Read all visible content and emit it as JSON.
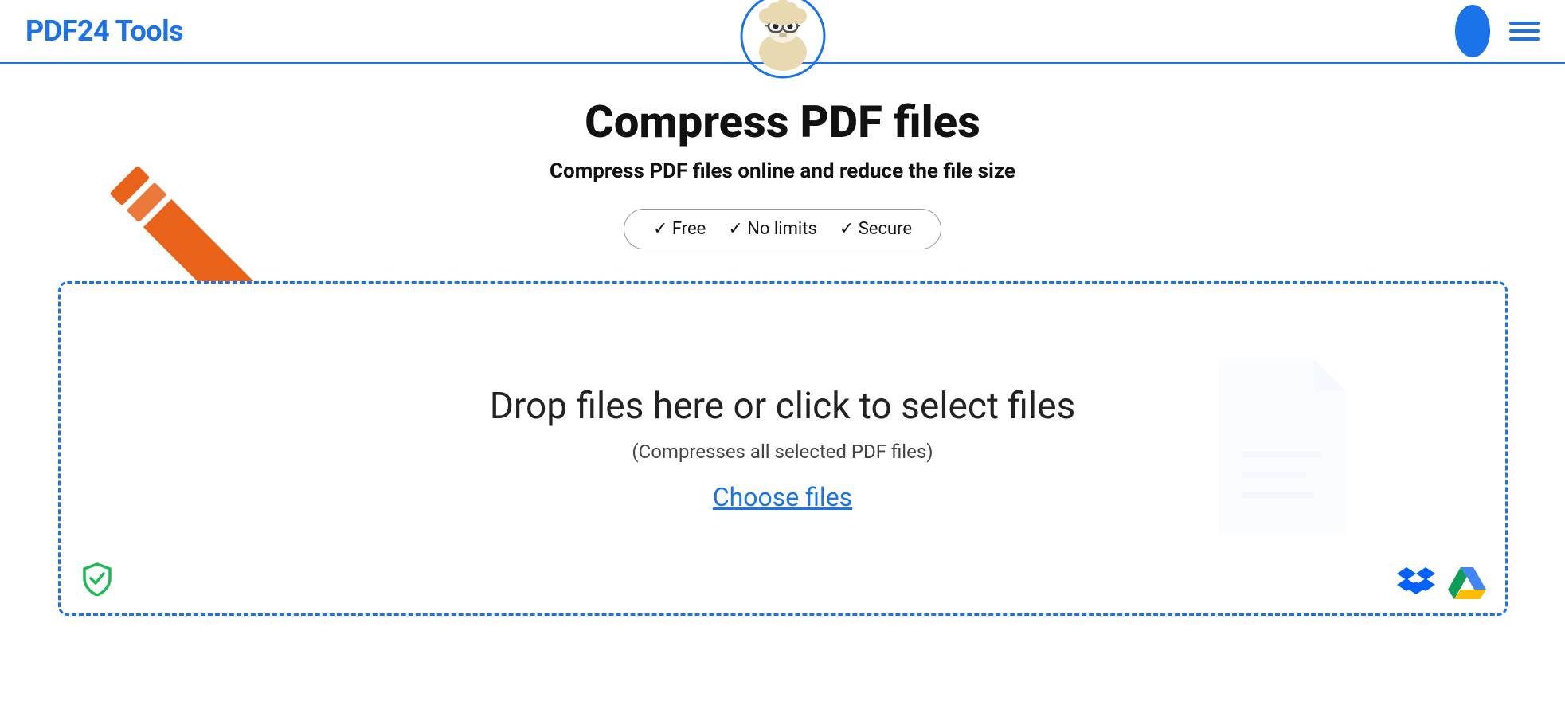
{
  "header": {
    "logo": "PDF24 Tools",
    "avatar_label": "user-avatar",
    "menu_label": "menu"
  },
  "hero": {
    "title": "Compress PDF files",
    "subtitle": "Compress PDF files online and reduce the file size",
    "badges": [
      "✓ Free",
      "✓ No limits",
      "✓ Secure"
    ]
  },
  "dropzone": {
    "main_text": "Drop files here or click to select files",
    "sub_text": "(Compresses all selected PDF files)",
    "choose_files_label": "Choose files"
  },
  "colors": {
    "brand_blue": "#1a73e8",
    "arrow_orange": "#e8621a",
    "shield_green": "#1db954"
  }
}
